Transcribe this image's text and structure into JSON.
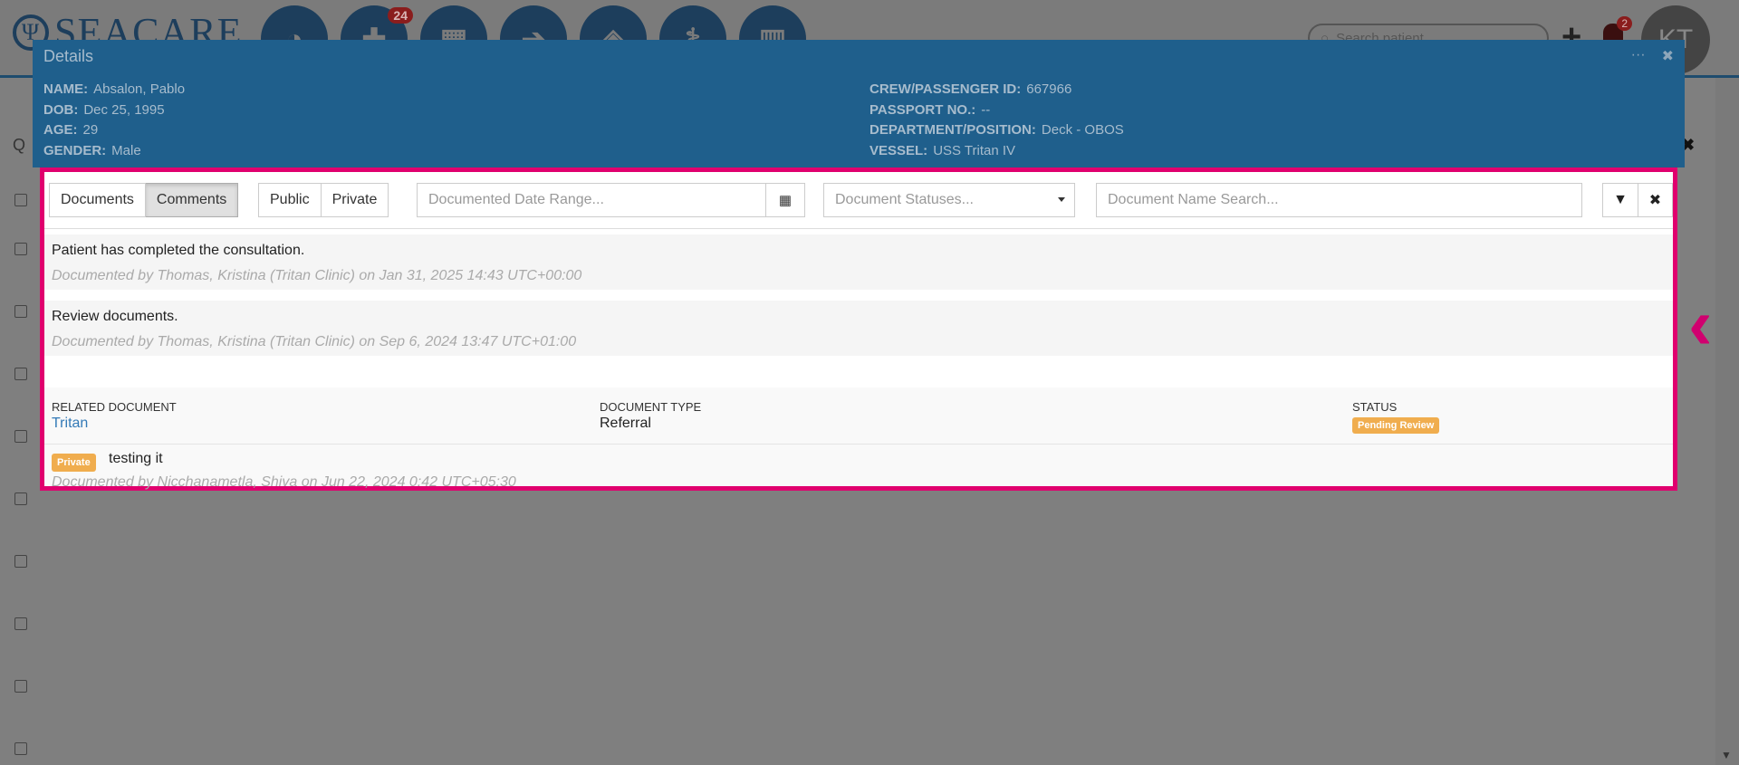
{
  "app": {
    "logo_text": "SEACARE",
    "nav_badge_count": "24",
    "search_placeholder": "Search patient",
    "notification_count": "2",
    "avatar_initials": "KT"
  },
  "modal": {
    "title": "Details",
    "ctrl_minimize": "···",
    "ctrl_close": "✖",
    "patient": {
      "name_label": "NAME:",
      "name": "Absalon, Pablo",
      "dob_label": "DOB:",
      "dob": "Dec 25, 1995",
      "age_label": "AGE:",
      "age": "29",
      "gender_label": "GENDER:",
      "gender": "Male",
      "crew_id_label": "CREW/PASSENGER ID:",
      "crew_id": "667966",
      "passport_label": "PASSPORT NO.:",
      "passport": "--",
      "department_label": "DEPARTMENT/POSITION:",
      "department": "Deck - OBOS",
      "vessel_label": "VESSEL:",
      "vessel": "USS Tritan IV"
    }
  },
  "toolbar": {
    "documents_tab": "Documents",
    "comments_tab": "Comments",
    "public_btn": "Public",
    "private_btn": "Private",
    "date_range_placeholder": "Documented Date Range...",
    "statuses_placeholder": "Document Statuses...",
    "name_search_placeholder": "Document Name Search..."
  },
  "comments": [
    {
      "text": "Patient has completed the consultation.",
      "meta": "Documented by Thomas, Kristina (Tritan Clinic) on Jan 31, 2025 14:43 UTC+00:00"
    },
    {
      "text": "Review documents.",
      "meta": "Documented by Thomas, Kristina (Tritan Clinic) on Sep 6, 2024 13:47 UTC+01:00"
    }
  ],
  "related": {
    "doc_header": "RELATED DOCUMENT",
    "doc_value": "Tritan",
    "type_header": "DOCUMENT TYPE",
    "type_value": "Referral",
    "status_header": "STATUS",
    "status_value": "Pending Review",
    "private_badge": "Private",
    "comment_text": "testing it",
    "comment_meta": "Documented by Nicchanametla, Shiva on Jun 22, 2024 0:42 UTC+05:30"
  },
  "colors": {
    "highlight_border": "#e0006e",
    "modal_header": "#1f5f8c",
    "badge_warning": "#f0ad4e",
    "link": "#337ab7"
  }
}
